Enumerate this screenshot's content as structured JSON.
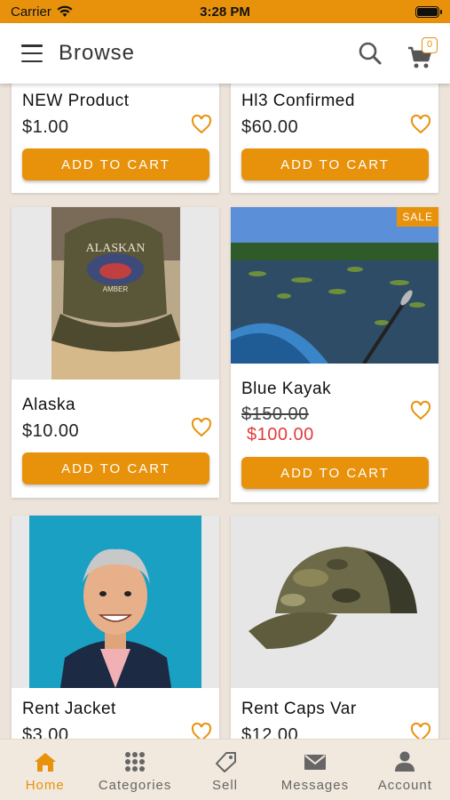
{
  "status_bar": {
    "carrier": "Carrier",
    "time": "3:28 PM"
  },
  "header": {
    "title": "Browse",
    "cart_count": "0"
  },
  "colors": {
    "accent": "#e8920c",
    "sale_price": "#e23b3b",
    "background": "#ece4da"
  },
  "products": [
    {
      "name": "NEW Product",
      "price": "$1.00",
      "button": "ADD TO CART"
    },
    {
      "name": "Hl3 Confirmed",
      "price": "$60.00",
      "button": "ADD TO CART"
    },
    {
      "name": "Alaska",
      "price": "$10.00",
      "button": "ADD TO CART",
      "image": "olive cap with Alaskan Amber logo"
    },
    {
      "name": "Blue Kayak",
      "old_price": "$150.00",
      "price": "$100.00",
      "badge": "SALE",
      "button": "ADD TO CART",
      "image": "kayak on lake"
    },
    {
      "name": "Rent Jacket",
      "price": "$3.00",
      "image": "cartoon man in dark jacket"
    },
    {
      "name": "Rent Caps Var",
      "price": "$12.00",
      "image": "camouflage trucker cap"
    }
  ],
  "tabs": [
    {
      "label": "Home",
      "icon": "home-icon",
      "active": true
    },
    {
      "label": "Categories",
      "icon": "grid-icon"
    },
    {
      "label": "Sell",
      "icon": "tag-icon"
    },
    {
      "label": "Messages",
      "icon": "envelope-icon"
    },
    {
      "label": "Account",
      "icon": "person-icon"
    }
  ]
}
